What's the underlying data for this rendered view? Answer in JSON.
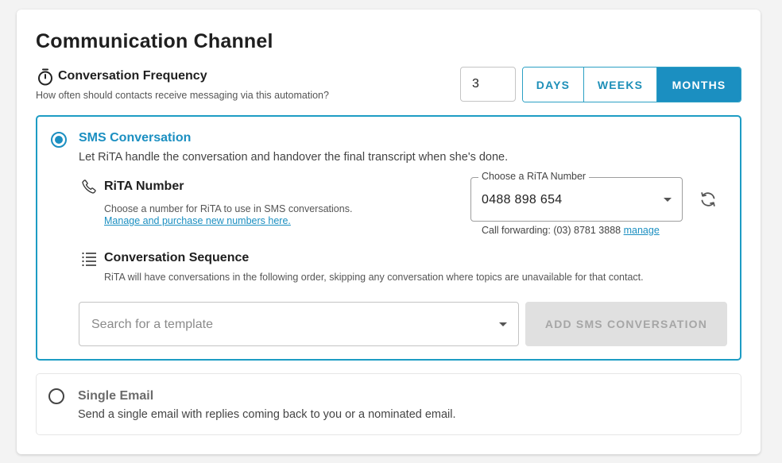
{
  "title": "Communication Channel",
  "frequency": {
    "icon": "timer-icon",
    "title": "Conversation Frequency",
    "description": "How often should contacts receive messaging via this automation?",
    "value": "3",
    "periods": [
      "DAYS",
      "WEEKS",
      "MONTHS"
    ],
    "selected_period": "MONTHS"
  },
  "sms": {
    "selected": true,
    "title": "SMS Conversation",
    "description": "Let RiTA handle the conversation and handover the final transcript when she's done.",
    "number": {
      "icon": "phone-icon",
      "title": "RiTA Number",
      "description": "Choose a number for RiTA to use in SMS conversations.",
      "link": "Manage and purchase new numbers here.",
      "select_label": "Choose a RiTA Number",
      "select_value": "0488 898 654",
      "forwarding_label": "Call forwarding: (03) 8781 3888",
      "forwarding_link": "manage"
    },
    "sequence": {
      "icon": "list-icon",
      "title": "Conversation Sequence",
      "description": "RiTA will have conversations in the following order, skipping any conversation where topics are unavailable for that contact.",
      "search_placeholder": "Search for a template",
      "add_button": "ADD SMS CONVERSATION"
    }
  },
  "email": {
    "selected": false,
    "title": "Single Email",
    "description": "Send a single email with replies coming back to you or a nominated email."
  },
  "colors": {
    "accent": "#1b8fc1",
    "border_accent": "#1d9cc4",
    "disabled_bg": "#e0e0e0"
  }
}
